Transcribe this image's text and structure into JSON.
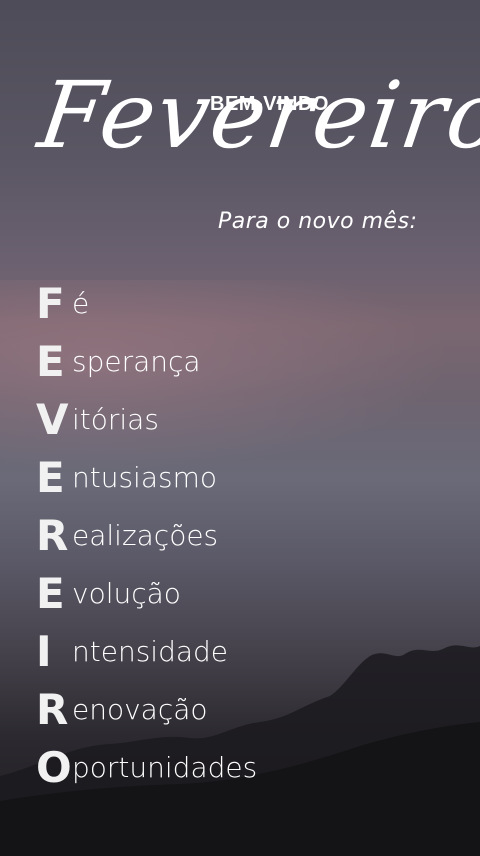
{
  "header": {
    "welcome": "BEM-VINDO",
    "month": "Fevereiro",
    "subtitle": "Para o novo mês:"
  },
  "acrostic": [
    {
      "letter": "F",
      "rest": "é"
    },
    {
      "letter": "E",
      "rest": "sperança"
    },
    {
      "letter": "V",
      "rest": "itórias"
    },
    {
      "letter": "E",
      "rest": "ntusiasmo"
    },
    {
      "letter": "R",
      "rest": "ealizações"
    },
    {
      "letter": "E",
      "rest": "volução"
    },
    {
      "letter": "I",
      "rest": "ntensidade"
    },
    {
      "letter": "R",
      "rest": "enovação"
    },
    {
      "letter": "O",
      "rest": "portunidades"
    }
  ]
}
